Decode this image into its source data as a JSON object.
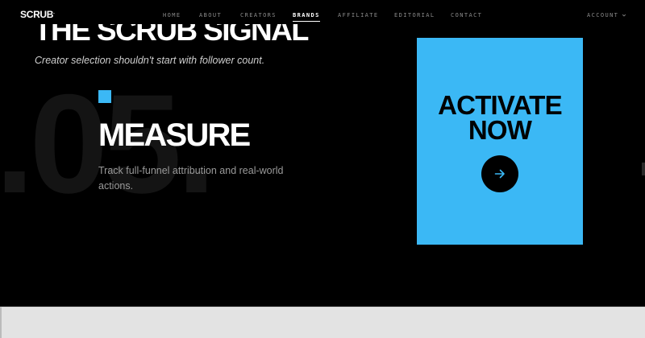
{
  "header": {
    "logo": "SCRUB",
    "logo_mark": ".",
    "nav": [
      {
        "label": "HOME",
        "active": false
      },
      {
        "label": "ABOUT",
        "active": false
      },
      {
        "label": "CREATORS",
        "active": false
      },
      {
        "label": "BRANDS",
        "active": true
      },
      {
        "label": "AFFILIATE",
        "active": false
      },
      {
        "label": "EDITORIAL",
        "active": false
      },
      {
        "label": "CONTACT",
        "active": false
      }
    ],
    "account_label": "ACCOUNT",
    "account_chevron": "chevron-down-icon"
  },
  "hero": {
    "title": "THE SCRUB SIGNAL",
    "subtitle": "Creator selection shouldn't start with follower count."
  },
  "feature": {
    "ghost_number": ".05.",
    "heading": "MEASURE",
    "description": "Track full-funnel attribution and real-world actions."
  },
  "cta": {
    "line1": "ACTIVATE",
    "line2": "NOW",
    "button_icon": "arrow-right-icon"
  },
  "colors": {
    "background": "#000000",
    "accent": "#3bb8f5",
    "nav_inactive": "#8a8a8a"
  }
}
